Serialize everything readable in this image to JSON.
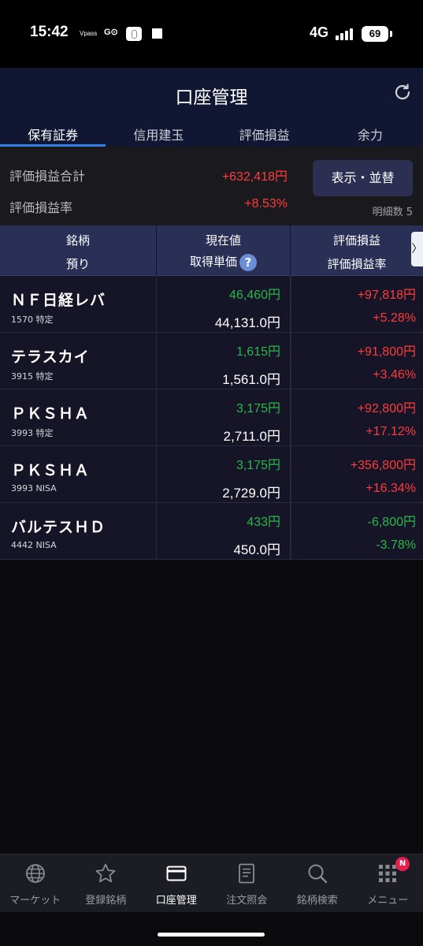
{
  "statusbar": {
    "time": "15:42",
    "vpass": "Vpass",
    "go": "G⊙",
    "network": "4G",
    "battery": "69"
  },
  "header": {
    "title": "口座管理",
    "tabs": [
      {
        "label": "保有証券",
        "active": true
      },
      {
        "label": "信用建玉",
        "active": false
      },
      {
        "label": "評価損益",
        "active": false
      },
      {
        "label": "余力",
        "active": false
      }
    ]
  },
  "summary": {
    "total_label": "評価損益合計",
    "total_value": "+632,418円",
    "rate_label": "評価損益率",
    "rate_value": "+8.53%",
    "display_button": "表示・並替",
    "detail_count": "明細数 5"
  },
  "table": {
    "headers": {
      "col1_top": "銘柄",
      "col1_bottom": "預り",
      "col2_top": "現在値",
      "col2_bottom": "取得単価",
      "col3_top": "評価損益",
      "col3_bottom": "評価損益率",
      "help": "?",
      "scroll_arrow": "〉"
    },
    "rows": [
      {
        "name": "ＮＦ日経レバ",
        "code": "1570 特定",
        "price": "46,460円",
        "cost": "44,131.0円",
        "pl": "+97,818円",
        "pl_rate": "+5.28%",
        "positive": true
      },
      {
        "name": "テラスカイ",
        "code": "3915 特定",
        "price": "1,615円",
        "cost": "1,561.0円",
        "pl": "+91,800円",
        "pl_rate": "+3.46%",
        "positive": true
      },
      {
        "name": "ＰＫＳＨＡ",
        "code": "3993 特定",
        "price": "3,175円",
        "cost": "2,711.0円",
        "pl": "+92,800円",
        "pl_rate": "+17.12%",
        "positive": true
      },
      {
        "name": "ＰＫＳＨＡ",
        "code": "3993 NISA",
        "price": "3,175円",
        "cost": "2,729.0円",
        "pl": "+356,800円",
        "pl_rate": "+16.34%",
        "positive": true
      },
      {
        "name": "バルテスＨＤ",
        "code": "4442 NISA",
        "price": "433円",
        "cost": "450.0円",
        "pl": "-6,800円",
        "pl_rate": "-3.78%",
        "positive": false
      }
    ]
  },
  "bottom_nav": {
    "items": [
      {
        "label": "マーケット",
        "icon": "globe-icon"
      },
      {
        "label": "登録銘柄",
        "icon": "star-icon"
      },
      {
        "label": "口座管理",
        "icon": "card-icon",
        "active": true
      },
      {
        "label": "注文照会",
        "icon": "document-icon"
      },
      {
        "label": "銘柄検索",
        "icon": "search-icon"
      },
      {
        "label": "メニュー",
        "icon": "grid-icon"
      }
    ],
    "badge": "N"
  },
  "colors": {
    "header_bg": "#111732",
    "accent_tab": "#2f7fe6",
    "positive": "#ff3b3b",
    "negative": "#29b84a",
    "badge": "#e5214b"
  }
}
